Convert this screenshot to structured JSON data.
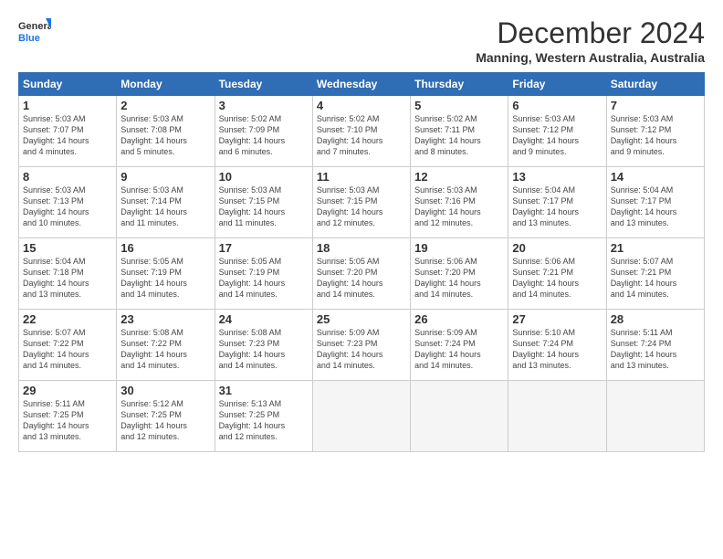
{
  "logo": {
    "line1": "General",
    "line2": "Blue"
  },
  "title": "December 2024",
  "location": "Manning, Western Australia, Australia",
  "weekdays": [
    "Sunday",
    "Monday",
    "Tuesday",
    "Wednesday",
    "Thursday",
    "Friday",
    "Saturday"
  ],
  "weeks": [
    [
      {
        "num": "1",
        "info": "Sunrise: 5:03 AM\nSunset: 7:07 PM\nDaylight: 14 hours\nand 4 minutes."
      },
      {
        "num": "2",
        "info": "Sunrise: 5:03 AM\nSunset: 7:08 PM\nDaylight: 14 hours\nand 5 minutes."
      },
      {
        "num": "3",
        "info": "Sunrise: 5:02 AM\nSunset: 7:09 PM\nDaylight: 14 hours\nand 6 minutes."
      },
      {
        "num": "4",
        "info": "Sunrise: 5:02 AM\nSunset: 7:10 PM\nDaylight: 14 hours\nand 7 minutes."
      },
      {
        "num": "5",
        "info": "Sunrise: 5:02 AM\nSunset: 7:11 PM\nDaylight: 14 hours\nand 8 minutes."
      },
      {
        "num": "6",
        "info": "Sunrise: 5:03 AM\nSunset: 7:12 PM\nDaylight: 14 hours\nand 9 minutes."
      },
      {
        "num": "7",
        "info": "Sunrise: 5:03 AM\nSunset: 7:12 PM\nDaylight: 14 hours\nand 9 minutes."
      }
    ],
    [
      {
        "num": "8",
        "info": "Sunrise: 5:03 AM\nSunset: 7:13 PM\nDaylight: 14 hours\nand 10 minutes."
      },
      {
        "num": "9",
        "info": "Sunrise: 5:03 AM\nSunset: 7:14 PM\nDaylight: 14 hours\nand 11 minutes."
      },
      {
        "num": "10",
        "info": "Sunrise: 5:03 AM\nSunset: 7:15 PM\nDaylight: 14 hours\nand 11 minutes."
      },
      {
        "num": "11",
        "info": "Sunrise: 5:03 AM\nSunset: 7:15 PM\nDaylight: 14 hours\nand 12 minutes."
      },
      {
        "num": "12",
        "info": "Sunrise: 5:03 AM\nSunset: 7:16 PM\nDaylight: 14 hours\nand 12 minutes."
      },
      {
        "num": "13",
        "info": "Sunrise: 5:04 AM\nSunset: 7:17 PM\nDaylight: 14 hours\nand 13 minutes."
      },
      {
        "num": "14",
        "info": "Sunrise: 5:04 AM\nSunset: 7:17 PM\nDaylight: 14 hours\nand 13 minutes."
      }
    ],
    [
      {
        "num": "15",
        "info": "Sunrise: 5:04 AM\nSunset: 7:18 PM\nDaylight: 14 hours\nand 13 minutes."
      },
      {
        "num": "16",
        "info": "Sunrise: 5:05 AM\nSunset: 7:19 PM\nDaylight: 14 hours\nand 14 minutes."
      },
      {
        "num": "17",
        "info": "Sunrise: 5:05 AM\nSunset: 7:19 PM\nDaylight: 14 hours\nand 14 minutes."
      },
      {
        "num": "18",
        "info": "Sunrise: 5:05 AM\nSunset: 7:20 PM\nDaylight: 14 hours\nand 14 minutes."
      },
      {
        "num": "19",
        "info": "Sunrise: 5:06 AM\nSunset: 7:20 PM\nDaylight: 14 hours\nand 14 minutes."
      },
      {
        "num": "20",
        "info": "Sunrise: 5:06 AM\nSunset: 7:21 PM\nDaylight: 14 hours\nand 14 minutes."
      },
      {
        "num": "21",
        "info": "Sunrise: 5:07 AM\nSunset: 7:21 PM\nDaylight: 14 hours\nand 14 minutes."
      }
    ],
    [
      {
        "num": "22",
        "info": "Sunrise: 5:07 AM\nSunset: 7:22 PM\nDaylight: 14 hours\nand 14 minutes."
      },
      {
        "num": "23",
        "info": "Sunrise: 5:08 AM\nSunset: 7:22 PM\nDaylight: 14 hours\nand 14 minutes."
      },
      {
        "num": "24",
        "info": "Sunrise: 5:08 AM\nSunset: 7:23 PM\nDaylight: 14 hours\nand 14 minutes."
      },
      {
        "num": "25",
        "info": "Sunrise: 5:09 AM\nSunset: 7:23 PM\nDaylight: 14 hours\nand 14 minutes."
      },
      {
        "num": "26",
        "info": "Sunrise: 5:09 AM\nSunset: 7:24 PM\nDaylight: 14 hours\nand 14 minutes."
      },
      {
        "num": "27",
        "info": "Sunrise: 5:10 AM\nSunset: 7:24 PM\nDaylight: 14 hours\nand 13 minutes."
      },
      {
        "num": "28",
        "info": "Sunrise: 5:11 AM\nSunset: 7:24 PM\nDaylight: 14 hours\nand 13 minutes."
      }
    ],
    [
      {
        "num": "29",
        "info": "Sunrise: 5:11 AM\nSunset: 7:25 PM\nDaylight: 14 hours\nand 13 minutes."
      },
      {
        "num": "30",
        "info": "Sunrise: 5:12 AM\nSunset: 7:25 PM\nDaylight: 14 hours\nand 12 minutes."
      },
      {
        "num": "31",
        "info": "Sunrise: 5:13 AM\nSunset: 7:25 PM\nDaylight: 14 hours\nand 12 minutes."
      },
      null,
      null,
      null,
      null
    ]
  ]
}
